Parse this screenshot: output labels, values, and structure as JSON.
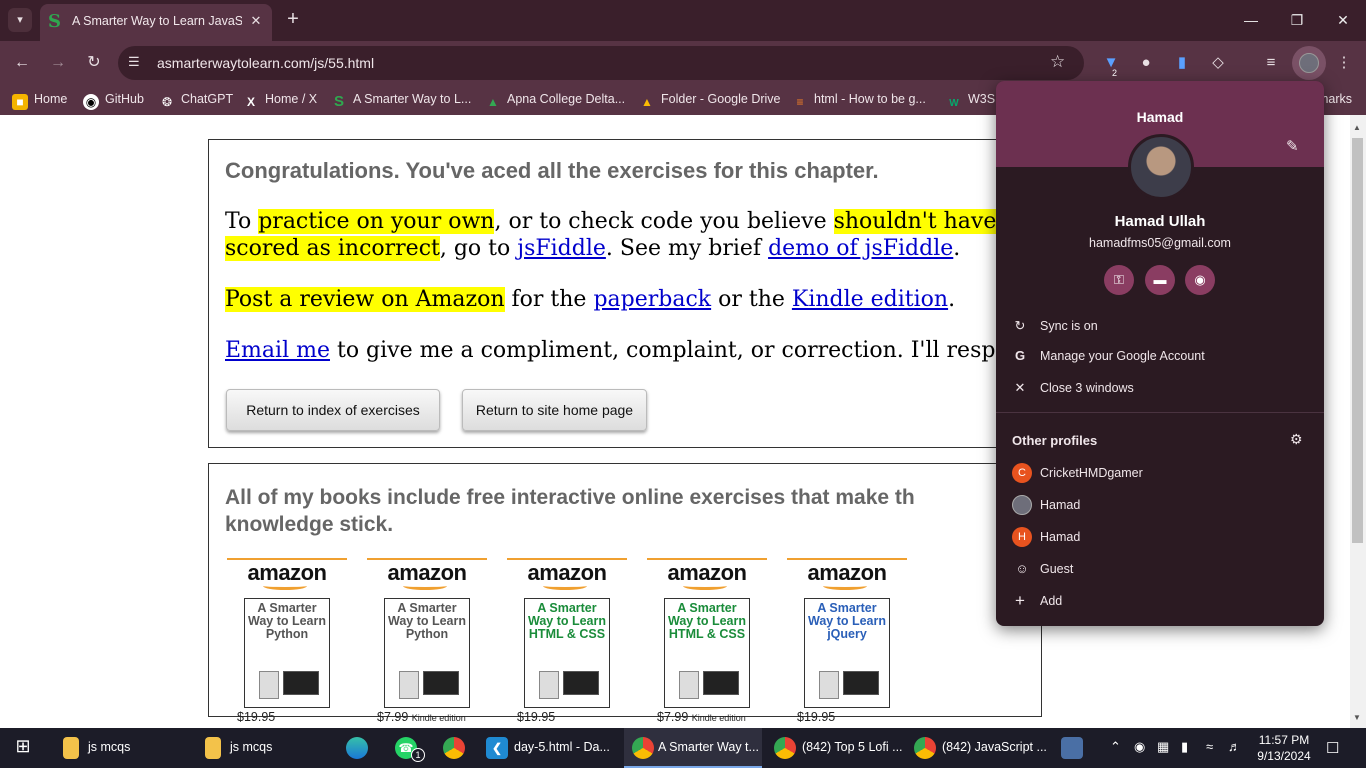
{
  "browser": {
    "tab_title": "A Smarter Way to Learn JavaSc",
    "tab_favicon": "S",
    "url": "asmarterwaytolearn.com/js/55.html",
    "extension_badge": "2"
  },
  "bookmarks": [
    {
      "label": "Home",
      "icon": "home-icon",
      "color": "#f4b400"
    },
    {
      "label": "GitHub",
      "icon": "github-icon",
      "color": "#ffffff"
    },
    {
      "label": "ChatGPT",
      "icon": "chatgpt-icon",
      "color": "#ffffff"
    },
    {
      "label": "Home / X",
      "icon": "x-icon",
      "color": "#ffffff"
    },
    {
      "label": "A Smarter Way to L...",
      "icon": "s-icon",
      "color": "#2fa84f"
    },
    {
      "label": "Apna College Delta...",
      "icon": "drive-icon",
      "color": "#34a853"
    },
    {
      "label": "Folder - Google Drive",
      "icon": "drive-icon",
      "color": "#34a853"
    },
    {
      "label": "html - How to be g...",
      "icon": "stackoverflow-icon",
      "color": "#f48024"
    },
    {
      "label": "W3S",
      "icon": "w3s-icon",
      "color": "#04aa6d"
    },
    {
      "label": "marks",
      "icon": "",
      "color": ""
    }
  ],
  "content": {
    "congrats": "Congratulations. You've aced all the exercises for this chapter.",
    "p1": {
      "t1": "To ",
      "h1": "practice on your own",
      "t2": ", or to check code you believe ",
      "h2": "shouldn't have been",
      "h3": "scored as incorrect",
      "t3": ", go to ",
      "l1": "jsFiddle",
      "t4": ". See my brief ",
      "l2": "demo of jsFiddle",
      "t5": "."
    },
    "p2": {
      "h1": "Post a review on Amazon",
      "t1": " for the ",
      "l1": "paperback",
      "t2": " or the ",
      "l2": "Kindle edition",
      "t3": "."
    },
    "p3": {
      "l1": "Email me",
      "t1": " to give me a compliment, complaint, or correction. I'll respond"
    },
    "btn_index": "Return to index of exercises",
    "btn_home": "Return to site home page",
    "books_heading": " All of my books include free interactive online exercises that make th knowledge stick.",
    "books": [
      {
        "logo": "amazon",
        "title": "A Smarter Way to Learn Python",
        "title_color": "#555555",
        "price": "$19.95",
        "edition": ""
      },
      {
        "logo": "amazon",
        "title": "A Smarter Way to Learn Python",
        "title_color": "#555555",
        "price": "$7.99",
        "edition": "Kindle edition"
      },
      {
        "logo": "amazon",
        "title": "A Smarter Way to Learn HTML & CSS",
        "title_color": "#1a8c3a",
        "price": "$19.95",
        "edition": ""
      },
      {
        "logo": "amazon",
        "title": "A Smarter Way to Learn HTML & CSS",
        "title_color": "#1a8c3a",
        "price": "$7.99",
        "edition": "Kindle edition"
      },
      {
        "logo": "amazon",
        "title": "A Smarter Way to Learn jQuery",
        "title_color": "#2a5fb8",
        "price": "$19.95",
        "edition": ""
      }
    ]
  },
  "profile_popup": {
    "header_name": "Hamad",
    "full_name": "Hamad Ullah",
    "email": "hamadfms05@gmail.com",
    "actions": [
      {
        "label": "Sync is on",
        "icon": "sync-icon"
      },
      {
        "label": "Manage your Google Account",
        "icon": "google-icon"
      },
      {
        "label": "Close 3 windows",
        "icon": "close-icon"
      }
    ],
    "other_profiles_label": "Other profiles",
    "profiles": [
      {
        "label": "CricketHMDgamer",
        "initial": "C",
        "color": "#e8531f"
      },
      {
        "label": "Hamad",
        "initial": "",
        "color": "#555555"
      },
      {
        "label": "Hamad",
        "initial": "H",
        "color": "#e8531f"
      },
      {
        "label": "Guest",
        "initial": "",
        "color": ""
      },
      {
        "label": "Add",
        "initial": "",
        "color": ""
      }
    ]
  },
  "taskbar": {
    "items": [
      {
        "label": "js mcqs",
        "icon": "folder-icon"
      },
      {
        "label": "js mcqs",
        "icon": "folder-icon"
      },
      {
        "label": "",
        "icon": "edge-icon"
      },
      {
        "label": "",
        "icon": "whatsapp-icon",
        "badge": "1"
      },
      {
        "label": "",
        "icon": "chrome-icon"
      },
      {
        "label": "day-5.html - Da...",
        "icon": "vscode-icon"
      },
      {
        "label": "A Smarter Way t...",
        "icon": "chrome-icon"
      },
      {
        "label": "(842) Top 5 Lofi ...",
        "icon": "chrome-icon"
      },
      {
        "label": "(842) JavaScript ...",
        "icon": "chrome-icon"
      }
    ],
    "time": "11:57 PM",
    "date": "9/13/2024"
  }
}
